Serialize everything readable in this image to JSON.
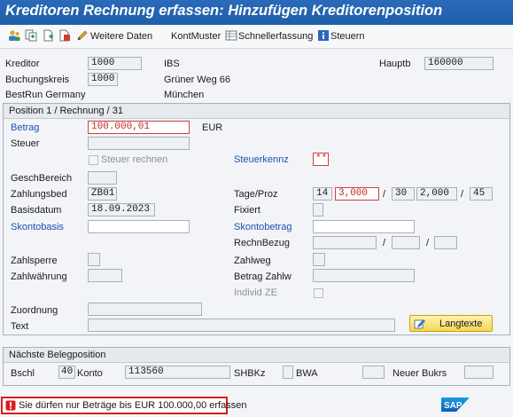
{
  "window": {
    "title": "Kreditoren Rechnung erfassen: Hinzufügen Kreditorenposition"
  },
  "toolbar": {
    "weitere_daten": "Weitere Daten",
    "kontmuster": "KontMuster",
    "schnellerfassung": "Schnellerfassung",
    "steuern": "Steuern"
  },
  "header": {
    "kreditor_label": "Kreditor",
    "kreditor_value": "1000",
    "kreditor_name": "IBS",
    "hauptb_label": "Hauptb",
    "hauptb_value": "160000",
    "buchungskreis_label": "Buchungskreis",
    "buchungskreis_value": "1000",
    "street": "Grüner Weg 66",
    "company": "BestRun Germany",
    "city": "München"
  },
  "position": {
    "title": "Position 1 / Rechnung / 31",
    "betrag_label": "Betrag",
    "betrag_value": "100.000,01",
    "currency": "EUR",
    "steuer_label": "Steuer",
    "steuer_rechnen": "Steuer rechnen",
    "steuerkennz_label": "Steuerkennz",
    "steuerkennz_value": "**",
    "geschbereich_label": "GeschBereich",
    "zahlungsbed_label": "Zahlungsbed",
    "zahlungsbed_value": "ZB01",
    "tage_proz_label": "Tage/Proz",
    "tage1": "14",
    "proz1": "3,000",
    "tage2": "30",
    "proz2": "2,000",
    "tage3": "45",
    "slash": "/",
    "basisdatum_label": "Basisdatum",
    "basisdatum_value": "18.09.2023",
    "fixiert_label": "Fixiert",
    "skontobasis_label": "Skontobasis",
    "skontobetrag_label": "Skontobetrag",
    "rechnbezug_label": "RechnBezug",
    "zahlsperre_label": "Zahlsperre",
    "zahlweg_label": "Zahlweg",
    "zahlwaehrung_label": "Zahlwährung",
    "betrag_zahlw_label": "Betrag Zahlw",
    "individ_ze_label": "Individ ZE",
    "zuordnung_label": "Zuordnung",
    "text_label": "Text",
    "langtexte_button": "Langtexte"
  },
  "next": {
    "title": "Nächste Belegposition",
    "bschl_label": "Bschl",
    "bschl_value": "40",
    "konto_label": "Konto",
    "konto_value": "113560",
    "shbkz_label": "SHBKz",
    "bwa_label": "BWA",
    "neuer_bukrs_label": "Neuer Bukrs"
  },
  "status": {
    "message": "Sie dürfen nur Beträge bis EUR 100.000,00 erfassen",
    "type": "error",
    "color": "#d81e1e"
  },
  "branding": {
    "logo": "SAP"
  }
}
